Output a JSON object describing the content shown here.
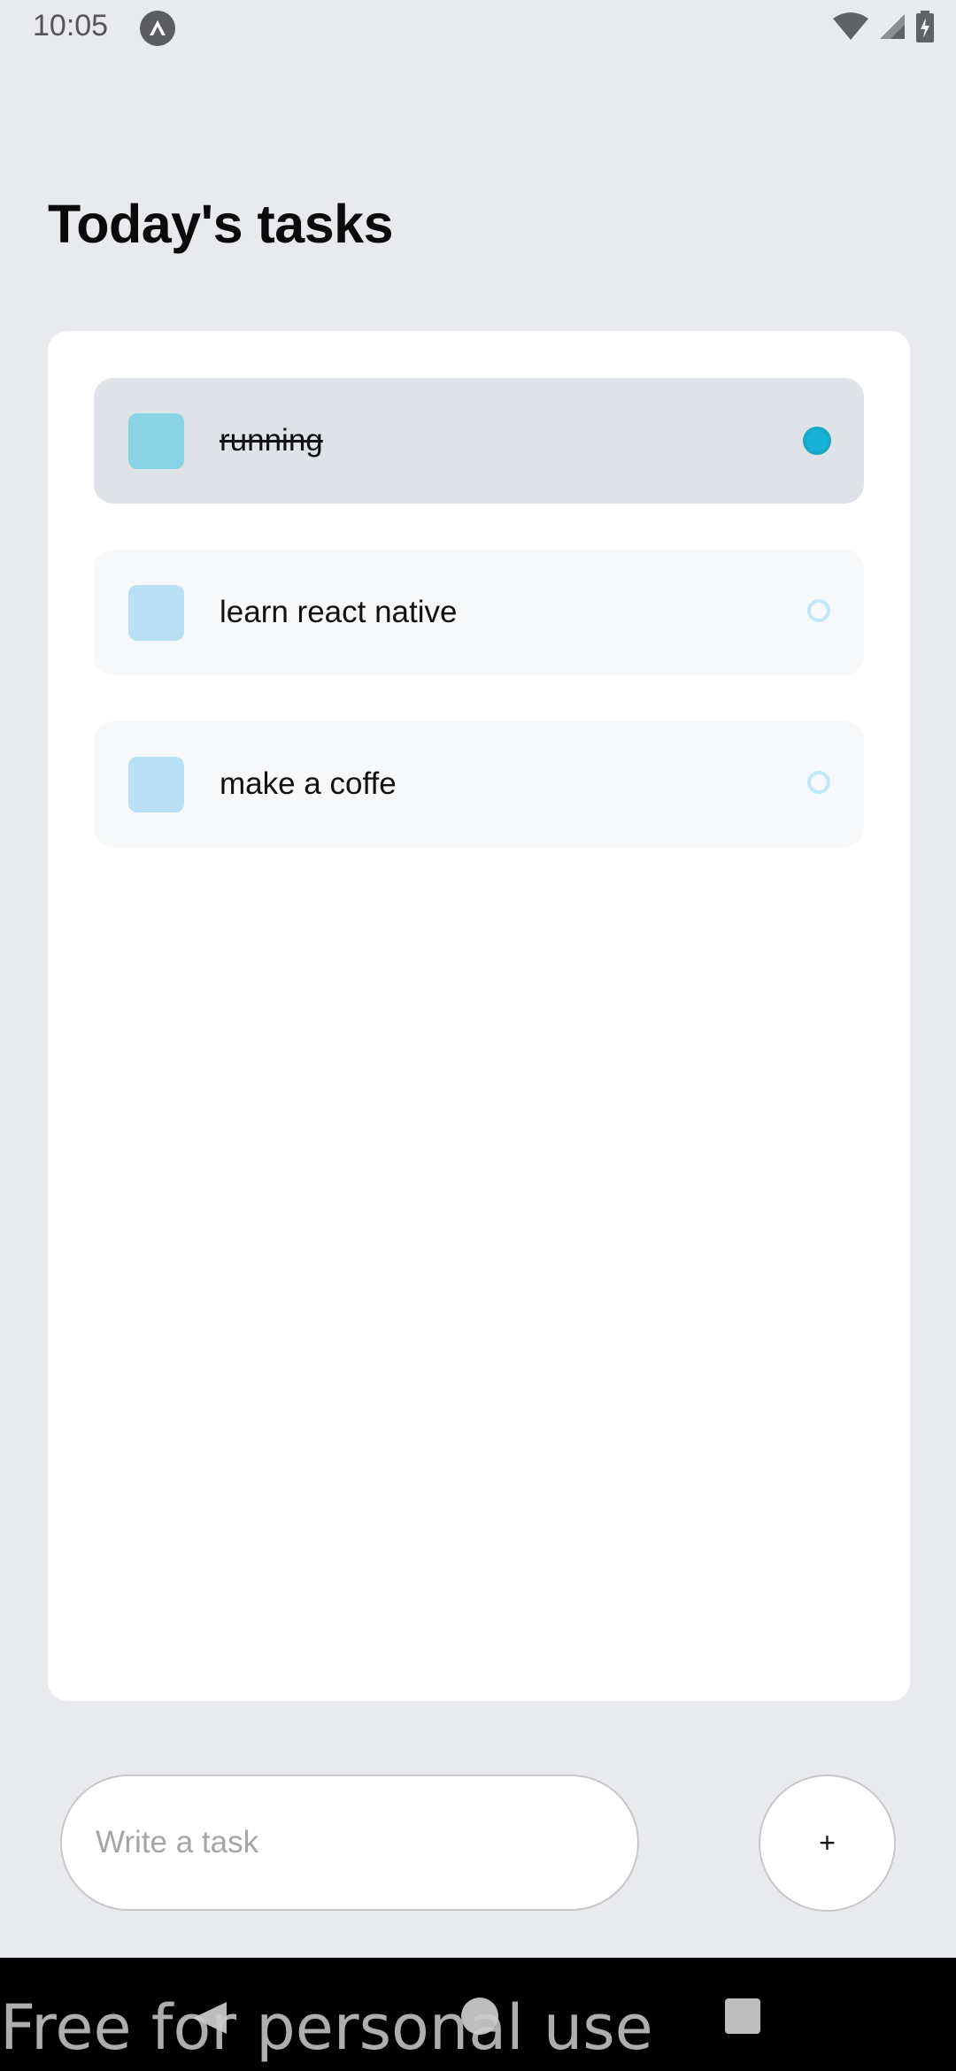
{
  "status_bar": {
    "time": "10:05",
    "icons": [
      "expo-icon",
      "wifi-icon",
      "cellular-signal-icon",
      "battery-charging-icon"
    ]
  },
  "header": {
    "title": "Today's tasks"
  },
  "tasks": [
    {
      "label": "running",
      "completed": true
    },
    {
      "label": "learn react native",
      "completed": false
    },
    {
      "label": "make a coffe",
      "completed": false
    }
  ],
  "input": {
    "placeholder": "Write a task",
    "value": ""
  },
  "add_button": {
    "label": "+"
  },
  "nav_bar": {
    "icons": [
      "back-icon",
      "home-icon",
      "recents-icon"
    ]
  },
  "watermark": {
    "text": "Free for personal use"
  },
  "colors": {
    "background": "#e8eaed",
    "card": "#ffffff",
    "task_bg": "#f6f8fa",
    "task_done_bg": "#dfe2e6",
    "task_square": "#b9e1f6",
    "task_square_done": "#89d4e4",
    "circle_outline": "#bfe9f7",
    "circle_done": "#16b3d6"
  }
}
